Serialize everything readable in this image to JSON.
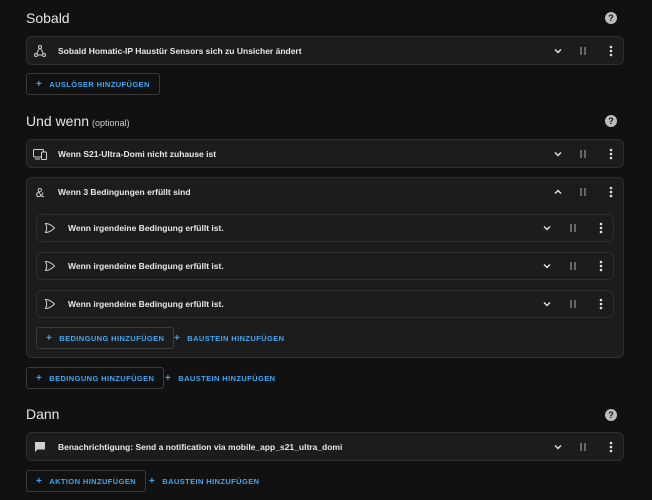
{
  "sections": {
    "triggers": {
      "title": "Sobald"
    },
    "conditions": {
      "title": "Und wenn",
      "optional": "(optional)"
    },
    "actions": {
      "title": "Dann"
    }
  },
  "trigger_item": {
    "label": "Sobald Homatic-IP Haustür Sensors sich zu Unsicher ändert",
    "icon": "trigger-icon"
  },
  "condition_items": [
    {
      "label": "Wenn S21-Ultra-Domi nicht zuhause ist",
      "icon": "device-icon"
    },
    {
      "label": "Wenn 3 Bedingungen erfüllt sind",
      "icon": "ampersand-icon",
      "children": [
        {
          "label": "Wenn irgendeine Bedingung erfüllt ist.",
          "icon": "or-gate-icon"
        },
        {
          "label": "Wenn irgendeine Bedingung erfüllt ist.",
          "icon": "or-gate-icon"
        },
        {
          "label": "Wenn irgendeine Bedingung erfüllt ist.",
          "icon": "or-gate-icon"
        }
      ]
    }
  ],
  "action_item": {
    "label": "Benachrichtigung: Send a notification via mobile_app_s21_ultra_domi",
    "icon": "message-icon"
  },
  "buttons": {
    "add_trigger": "AUSLÖSER HINZUFÜGEN",
    "add_condition": "BEDINGUNG HINZUFÜGEN",
    "add_block": "BAUSTEIN HINZUFÜGEN",
    "add_action": "AKTION HINZUFÜGEN",
    "help": "?"
  },
  "colors": {
    "accent": "#3fa7f0",
    "background": "#111111",
    "card": "#1c1c1c",
    "border": "#2e2e2e"
  }
}
